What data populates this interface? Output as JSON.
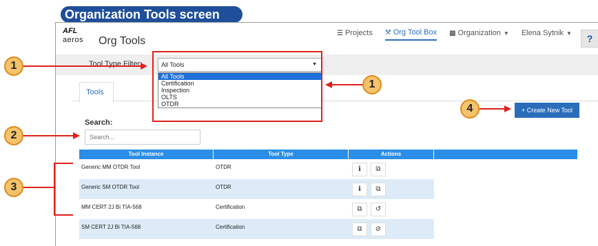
{
  "title": "Organization Tools screen",
  "logo": {
    "brand": "AFL",
    "product": "aeros"
  },
  "app_title": "Org Tools",
  "nav": {
    "projects": "Projects",
    "org_tool_box": "Org Tool Box",
    "organization": "Organization",
    "user": "Elena Sytnik",
    "help": "?"
  },
  "filter": {
    "label": "Tool Type Filter:",
    "selected": "All Tools",
    "options": [
      "All Tools",
      "Certification",
      "Inspection",
      "OLTS",
      "OTDR"
    ]
  },
  "tabs": {
    "tools": "Tools"
  },
  "create_button": "+ Create New Tool",
  "search": {
    "label": "Search:",
    "placeholder": "Search..."
  },
  "table": {
    "headers": [
      "Tool Instance",
      "Tool Type",
      "Actions",
      ""
    ],
    "rows": [
      {
        "instance": "Generic MM OTDR Tool",
        "type": "OTDR",
        "actions": [
          "info-icon",
          "copy-icon"
        ]
      },
      {
        "instance": "Generic SM OTDR Tool",
        "type": "OTDR",
        "actions": [
          "info-icon",
          "copy-icon"
        ]
      },
      {
        "instance": "MM CERT 2J Bi TIA-568",
        "type": "Certification",
        "actions": [
          "copy-icon",
          "restore-icon"
        ]
      },
      {
        "instance": "SM CERT 2J Bi TIA-568",
        "type": "Certification",
        "actions": [
          "copy-icon",
          "disable-icon"
        ]
      }
    ]
  },
  "callouts": [
    "1",
    "1",
    "2",
    "3",
    "4"
  ],
  "colors": {
    "accent": "#2a6ebb",
    "callout_fill": "#f5c36b",
    "annotation_red": "#e0201b",
    "title_blue": "#1f4f9a"
  }
}
